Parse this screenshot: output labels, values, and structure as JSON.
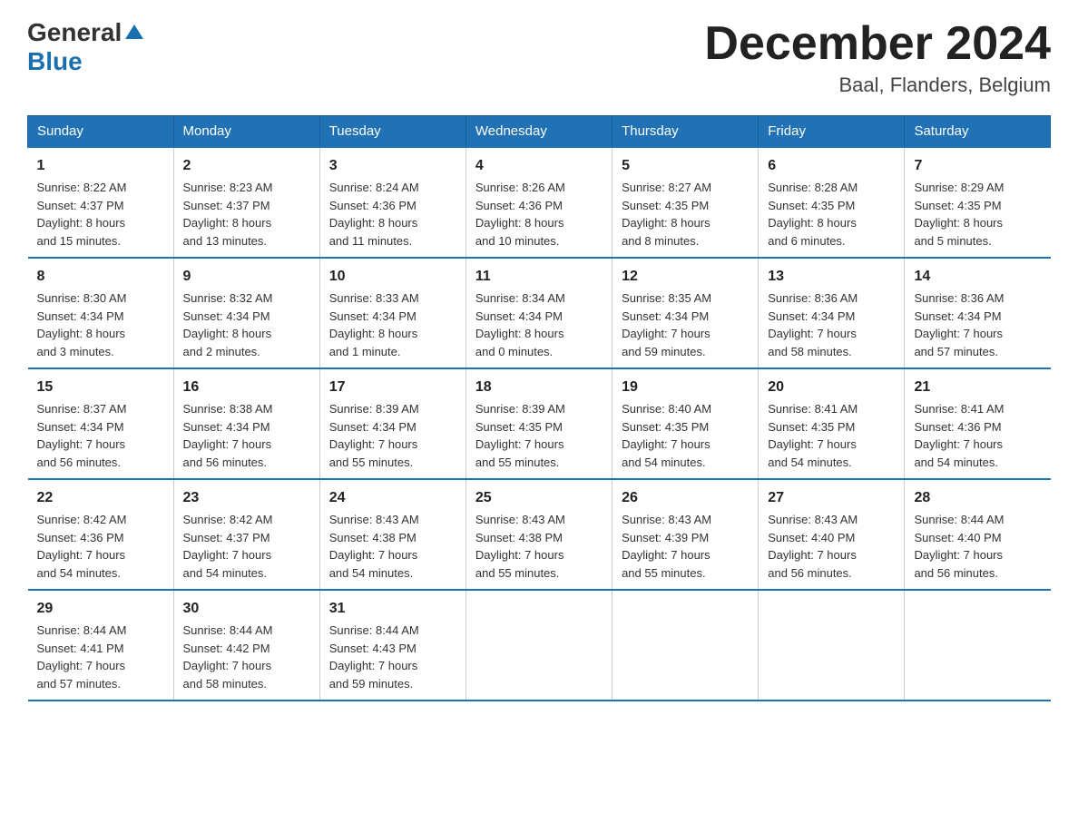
{
  "logo": {
    "general": "General",
    "blue": "Blue"
  },
  "header": {
    "month": "December 2024",
    "location": "Baal, Flanders, Belgium"
  },
  "weekdays": [
    "Sunday",
    "Monday",
    "Tuesday",
    "Wednesday",
    "Thursday",
    "Friday",
    "Saturday"
  ],
  "weeks": [
    [
      {
        "day": "1",
        "info": "Sunrise: 8:22 AM\nSunset: 4:37 PM\nDaylight: 8 hours\nand 15 minutes."
      },
      {
        "day": "2",
        "info": "Sunrise: 8:23 AM\nSunset: 4:37 PM\nDaylight: 8 hours\nand 13 minutes."
      },
      {
        "day": "3",
        "info": "Sunrise: 8:24 AM\nSunset: 4:36 PM\nDaylight: 8 hours\nand 11 minutes."
      },
      {
        "day": "4",
        "info": "Sunrise: 8:26 AM\nSunset: 4:36 PM\nDaylight: 8 hours\nand 10 minutes."
      },
      {
        "day": "5",
        "info": "Sunrise: 8:27 AM\nSunset: 4:35 PM\nDaylight: 8 hours\nand 8 minutes."
      },
      {
        "day": "6",
        "info": "Sunrise: 8:28 AM\nSunset: 4:35 PM\nDaylight: 8 hours\nand 6 minutes."
      },
      {
        "day": "7",
        "info": "Sunrise: 8:29 AM\nSunset: 4:35 PM\nDaylight: 8 hours\nand 5 minutes."
      }
    ],
    [
      {
        "day": "8",
        "info": "Sunrise: 8:30 AM\nSunset: 4:34 PM\nDaylight: 8 hours\nand 3 minutes."
      },
      {
        "day": "9",
        "info": "Sunrise: 8:32 AM\nSunset: 4:34 PM\nDaylight: 8 hours\nand 2 minutes."
      },
      {
        "day": "10",
        "info": "Sunrise: 8:33 AM\nSunset: 4:34 PM\nDaylight: 8 hours\nand 1 minute."
      },
      {
        "day": "11",
        "info": "Sunrise: 8:34 AM\nSunset: 4:34 PM\nDaylight: 8 hours\nand 0 minutes."
      },
      {
        "day": "12",
        "info": "Sunrise: 8:35 AM\nSunset: 4:34 PM\nDaylight: 7 hours\nand 59 minutes."
      },
      {
        "day": "13",
        "info": "Sunrise: 8:36 AM\nSunset: 4:34 PM\nDaylight: 7 hours\nand 58 minutes."
      },
      {
        "day": "14",
        "info": "Sunrise: 8:36 AM\nSunset: 4:34 PM\nDaylight: 7 hours\nand 57 minutes."
      }
    ],
    [
      {
        "day": "15",
        "info": "Sunrise: 8:37 AM\nSunset: 4:34 PM\nDaylight: 7 hours\nand 56 minutes."
      },
      {
        "day": "16",
        "info": "Sunrise: 8:38 AM\nSunset: 4:34 PM\nDaylight: 7 hours\nand 56 minutes."
      },
      {
        "day": "17",
        "info": "Sunrise: 8:39 AM\nSunset: 4:34 PM\nDaylight: 7 hours\nand 55 minutes."
      },
      {
        "day": "18",
        "info": "Sunrise: 8:39 AM\nSunset: 4:35 PM\nDaylight: 7 hours\nand 55 minutes."
      },
      {
        "day": "19",
        "info": "Sunrise: 8:40 AM\nSunset: 4:35 PM\nDaylight: 7 hours\nand 54 minutes."
      },
      {
        "day": "20",
        "info": "Sunrise: 8:41 AM\nSunset: 4:35 PM\nDaylight: 7 hours\nand 54 minutes."
      },
      {
        "day": "21",
        "info": "Sunrise: 8:41 AM\nSunset: 4:36 PM\nDaylight: 7 hours\nand 54 minutes."
      }
    ],
    [
      {
        "day": "22",
        "info": "Sunrise: 8:42 AM\nSunset: 4:36 PM\nDaylight: 7 hours\nand 54 minutes."
      },
      {
        "day": "23",
        "info": "Sunrise: 8:42 AM\nSunset: 4:37 PM\nDaylight: 7 hours\nand 54 minutes."
      },
      {
        "day": "24",
        "info": "Sunrise: 8:43 AM\nSunset: 4:38 PM\nDaylight: 7 hours\nand 54 minutes."
      },
      {
        "day": "25",
        "info": "Sunrise: 8:43 AM\nSunset: 4:38 PM\nDaylight: 7 hours\nand 55 minutes."
      },
      {
        "day": "26",
        "info": "Sunrise: 8:43 AM\nSunset: 4:39 PM\nDaylight: 7 hours\nand 55 minutes."
      },
      {
        "day": "27",
        "info": "Sunrise: 8:43 AM\nSunset: 4:40 PM\nDaylight: 7 hours\nand 56 minutes."
      },
      {
        "day": "28",
        "info": "Sunrise: 8:44 AM\nSunset: 4:40 PM\nDaylight: 7 hours\nand 56 minutes."
      }
    ],
    [
      {
        "day": "29",
        "info": "Sunrise: 8:44 AM\nSunset: 4:41 PM\nDaylight: 7 hours\nand 57 minutes."
      },
      {
        "day": "30",
        "info": "Sunrise: 8:44 AM\nSunset: 4:42 PM\nDaylight: 7 hours\nand 58 minutes."
      },
      {
        "day": "31",
        "info": "Sunrise: 8:44 AM\nSunset: 4:43 PM\nDaylight: 7 hours\nand 59 minutes."
      },
      {
        "day": "",
        "info": ""
      },
      {
        "day": "",
        "info": ""
      },
      {
        "day": "",
        "info": ""
      },
      {
        "day": "",
        "info": ""
      }
    ]
  ]
}
